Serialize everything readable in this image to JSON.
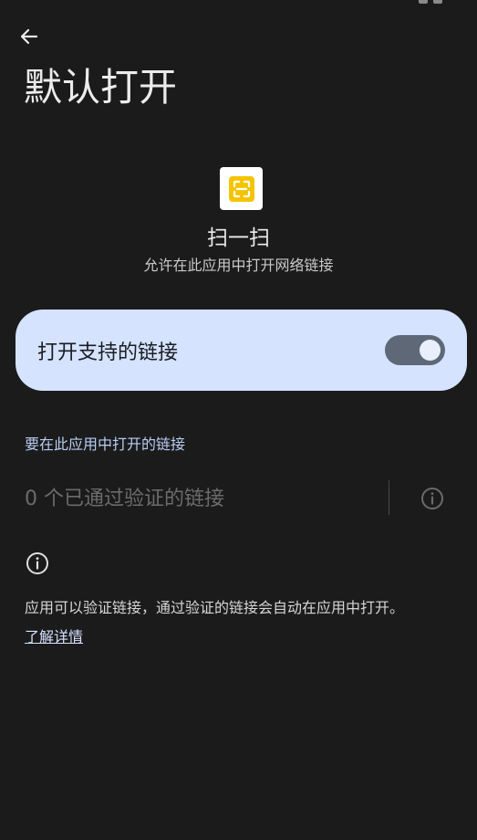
{
  "header": {
    "back_icon": "arrow-left-icon",
    "title": "默认打开"
  },
  "app": {
    "icon": "scan-icon",
    "icon_color": "#f5c400",
    "name": "扫一扫",
    "subtitle": "允许在此应用中打开网络链接"
  },
  "toggle": {
    "label": "打开支持的链接",
    "enabled": true,
    "card_color": "#d5e3fe"
  },
  "links_section": {
    "label": "要在此应用中打开的链接",
    "verified_text": "0 个已通过验证的链接",
    "info_icon": "info-icon"
  },
  "note": {
    "icon": "info-icon",
    "text": "应用可以验证链接，通过验证的链接会自动在应用中打开。",
    "learn_more": "了解详情"
  }
}
